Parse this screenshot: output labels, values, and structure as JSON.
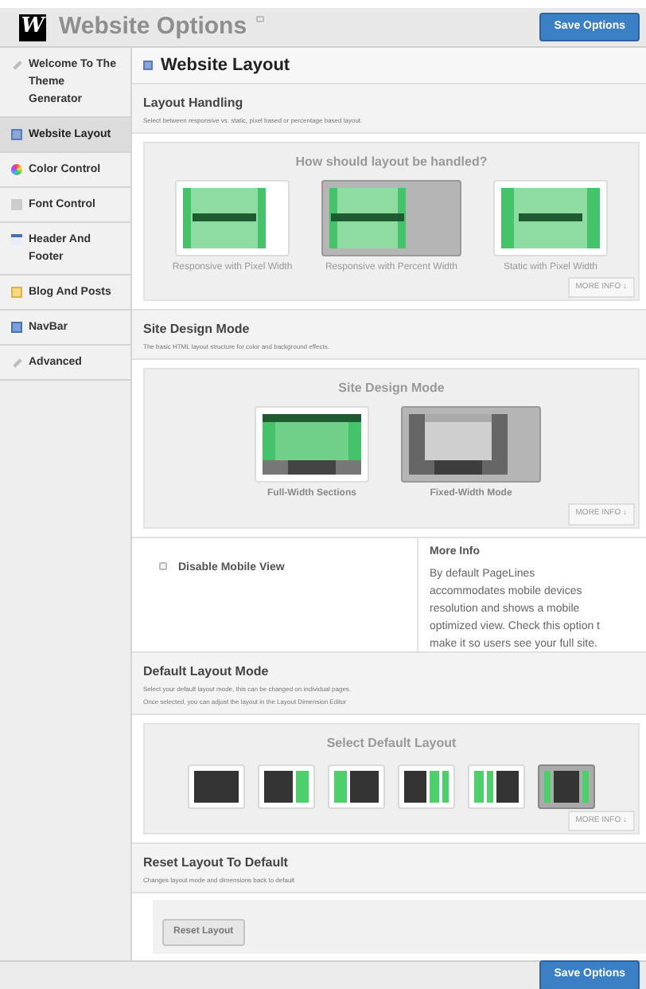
{
  "header": {
    "logo": "W",
    "title": "Website Options",
    "save_button": "Save Options"
  },
  "sidebar": {
    "items": [
      {
        "label": "Welcome To The Theme Generator",
        "kind": "pen",
        "selected": false
      },
      {
        "label": "Website Layout",
        "kind": "layout",
        "selected": true
      },
      {
        "label": "Color Control",
        "kind": "color",
        "selected": false
      },
      {
        "label": "Font Control",
        "kind": "font",
        "selected": false
      },
      {
        "label": "Header And Footer",
        "kind": "header",
        "selected": false
      },
      {
        "label": "Blog And Posts",
        "kind": "blog",
        "selected": false
      },
      {
        "label": "NavBar",
        "kind": "nav",
        "selected": false
      },
      {
        "label": "Advanced",
        "kind": "pen",
        "selected": false
      }
    ]
  },
  "page_title": "Website Layout",
  "sections": [
    {
      "kind": "images",
      "title": "Layout Handling",
      "descriptions": [
        "Select between responsive vs. static, pixel based or percentage based layout."
      ],
      "panel_title": "How should layout be handled?",
      "more_info": "MORE INFO ↓",
      "options": [
        {
          "label": "Responsive with Pixel Width",
          "kind": "responsive-pixel",
          "selected": false
        },
        {
          "label": "Responsive with Percent Width",
          "kind": "responsive-percent",
          "selected": true
        },
        {
          "label": "Static with Pixel Width",
          "kind": "static",
          "selected": false
        }
      ]
    },
    {
      "kind": "images",
      "title": "Site Design Mode",
      "descriptions": [
        "The basic HTML layout structure for color and background effects."
      ],
      "panel_title": "Site Design Mode",
      "more_info": "MORE INFO ↓",
      "options": [
        {
          "label": "Full-Width Sections",
          "kind": "full-width",
          "selected": false
        },
        {
          "label": "Fixed-Width Mode",
          "kind": "fixed-width",
          "selected": true
        }
      ]
    },
    {
      "kind": "checkbox",
      "label": "Disable Mobile View",
      "checked": false,
      "info_title": "More Info",
      "info_lines": [
        "By default PageLines",
        "accommodates mobile devices",
        "resolution and shows a mobile",
        "optimized view. Check this option t",
        "make it so users see your full site."
      ]
    },
    {
      "kind": "layouts",
      "title": "Default Layout Mode",
      "descriptions": [
        "Select your default layout mode, this can be changed on individual pages.",
        "Once selected, you can adjust the layout in the Layout Dimension Editor"
      ],
      "panel_title": "Select Default Layout",
      "more_info": "MORE INFO ↓",
      "options": [
        {
          "kind": "full",
          "selected": false
        },
        {
          "kind": "content-sidebar",
          "selected": false
        },
        {
          "kind": "sidebar-content",
          "selected": false
        },
        {
          "kind": "content-two-sidebars",
          "selected": false
        },
        {
          "kind": "two-sidebars-content",
          "selected": false
        },
        {
          "kind": "sidebar-content-sidebar",
          "selected": true
        }
      ]
    },
    {
      "kind": "button",
      "title": "Reset Layout To Default",
      "descriptions": [
        "Changes layout mode and dimensions back to default"
      ],
      "button": "Reset Layout"
    }
  ],
  "footer": {
    "save_button": "Save Options"
  }
}
